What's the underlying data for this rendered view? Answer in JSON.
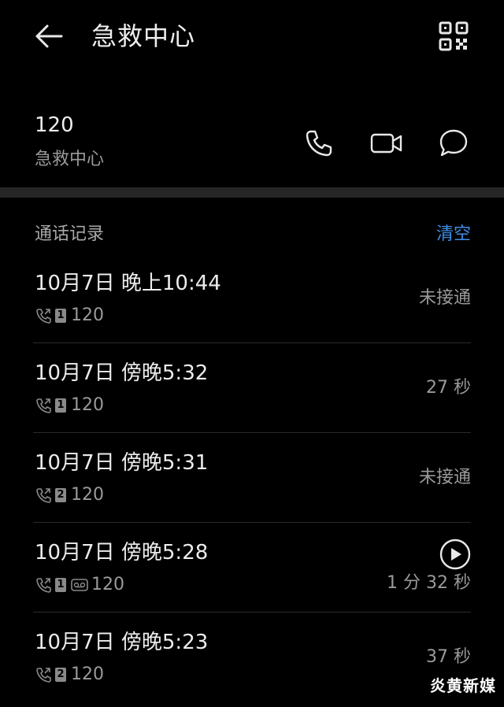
{
  "header": {
    "title": "急救中心"
  },
  "contact": {
    "number": "120",
    "name": "急救中心"
  },
  "section": {
    "title": "通话记录",
    "clear_label": "清空"
  },
  "calls": [
    {
      "time": "10月7日 晚上10:44",
      "sim": "1",
      "number": "120",
      "status": "未接通"
    },
    {
      "time": "10月7日 傍晚5:32",
      "sim": "1",
      "number": "120",
      "status": "27 秒"
    },
    {
      "time": "10月7日 傍晚5:31",
      "sim": "2",
      "number": "120",
      "status": "未接通"
    },
    {
      "time": "10月7日 傍晚5:28",
      "sim": "1",
      "number": "120",
      "status": "1 分 32 秒",
      "has_recording": true
    },
    {
      "time": "10月7日 傍晚5:23",
      "sim": "2",
      "number": "120",
      "status": "37 秒"
    }
  ],
  "watermark": "炎黄新媒",
  "colors": {
    "background": "#000000",
    "accent": "#3f8ee6",
    "divider": "#262626"
  },
  "icons": [
    "back-arrow-icon",
    "qr-code-icon",
    "phone-icon",
    "video-camera-icon",
    "chat-bubble-icon",
    "call-outgoing-icon",
    "sim-card-icon",
    "voicemail-icon",
    "play-icon"
  ]
}
